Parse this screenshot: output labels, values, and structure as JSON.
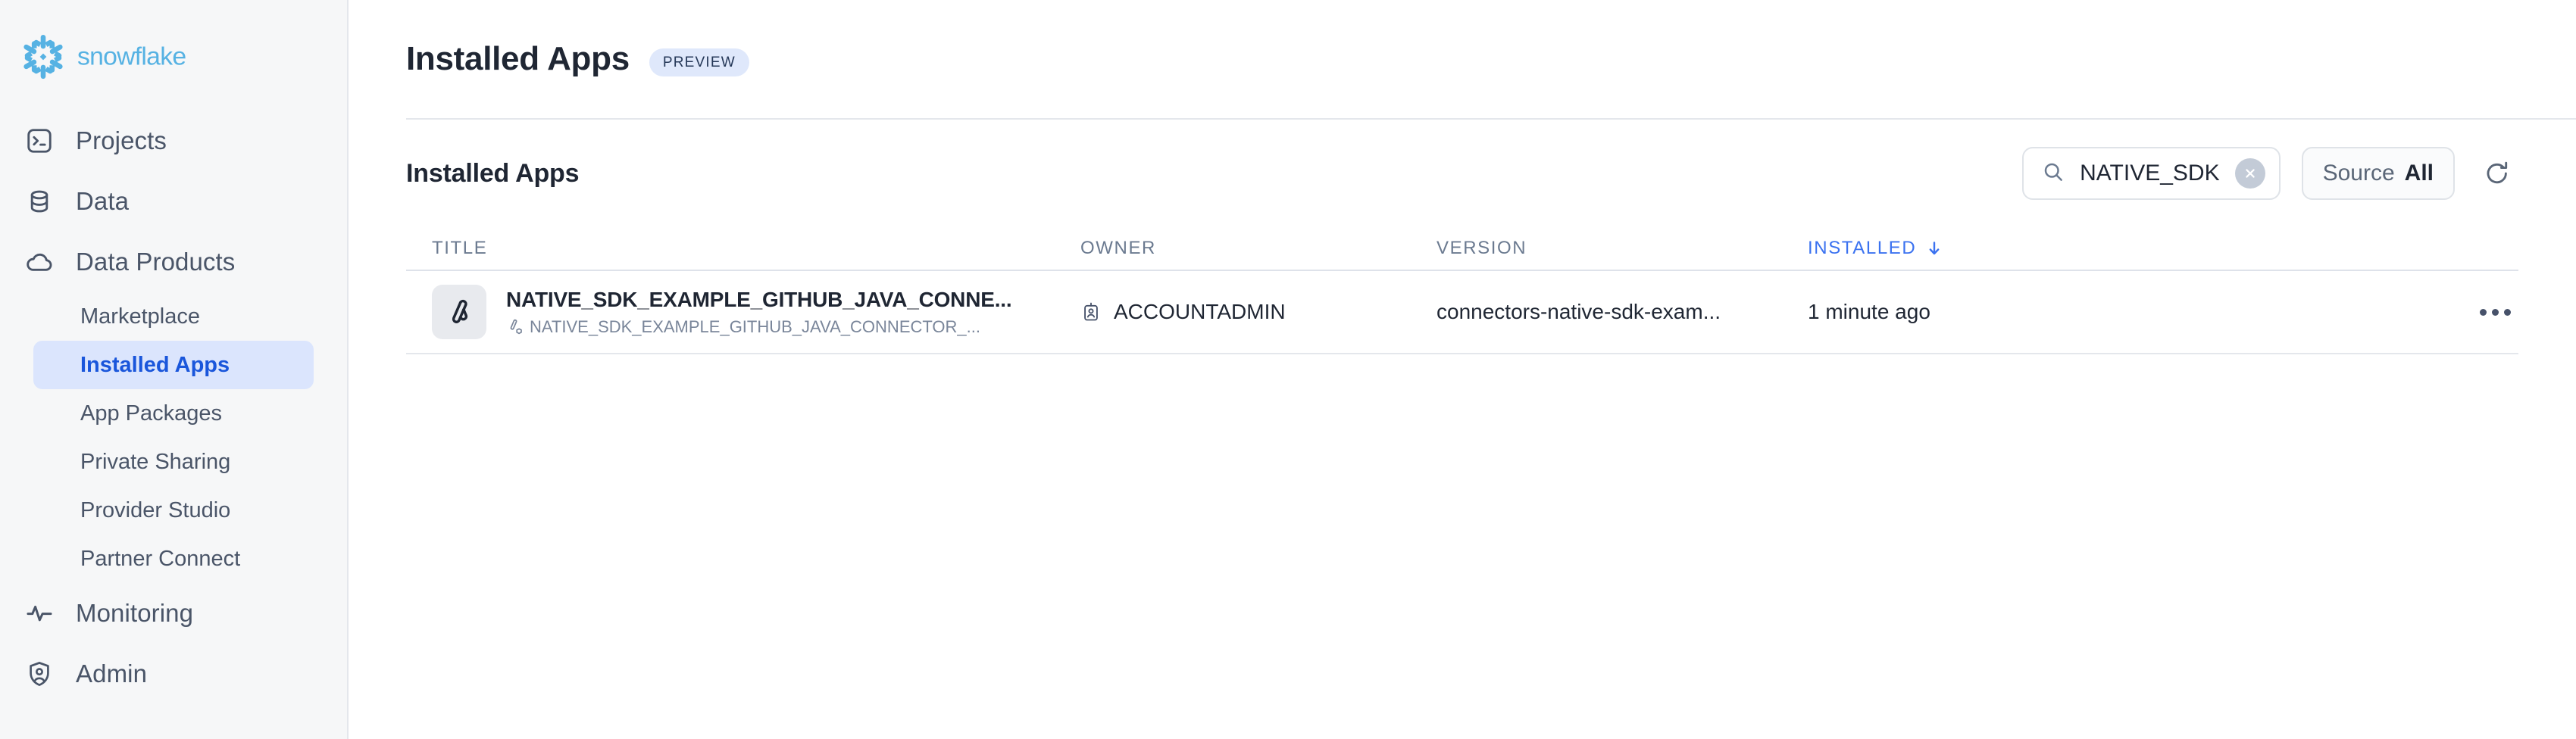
{
  "brand": {
    "name": "snowflake"
  },
  "sidebar": {
    "items": [
      {
        "label": "Projects",
        "icon": "terminal-icon",
        "type": "top"
      },
      {
        "label": "Data",
        "icon": "database-icon",
        "type": "top"
      },
      {
        "label": "Data Products",
        "icon": "cloud-icon",
        "type": "top"
      }
    ],
    "sub_items": [
      {
        "label": "Marketplace",
        "active": false
      },
      {
        "label": "Installed Apps",
        "active": true
      },
      {
        "label": "App Packages",
        "active": false
      },
      {
        "label": "Private Sharing",
        "active": false
      },
      {
        "label": "Provider Studio",
        "active": false
      },
      {
        "label": "Partner Connect",
        "active": false
      }
    ],
    "bottom_items": [
      {
        "label": "Monitoring",
        "icon": "activity-icon"
      },
      {
        "label": "Admin",
        "icon": "shield-user-icon"
      }
    ]
  },
  "header": {
    "title": "Installed Apps",
    "badge": "PREVIEW"
  },
  "section": {
    "title": "Installed Apps"
  },
  "search": {
    "value": "NATIVE_SDK",
    "placeholder": "Search",
    "icon": "search-icon",
    "clear_icon": "close-icon"
  },
  "filter": {
    "label": "Source",
    "value": "All"
  },
  "refresh": {
    "icon": "refresh-icon",
    "label": "Refresh"
  },
  "table": {
    "columns": [
      {
        "key": "title",
        "label": "TITLE",
        "sorted": false
      },
      {
        "key": "owner",
        "label": "OWNER",
        "sorted": false
      },
      {
        "key": "version",
        "label": "VERSION",
        "sorted": false
      },
      {
        "key": "installed",
        "label": "INSTALLED",
        "sorted": true,
        "sort_dir": "desc"
      }
    ],
    "rows": [
      {
        "icon": "native-app-icon",
        "title": "NATIVE_SDK_EXAMPLE_GITHUB_JAVA_CONNE...",
        "subtitle": "NATIVE_SDK_EXAMPLE_GITHUB_JAVA_CONNECTOR_...",
        "subtitle_icon": "app-package-icon",
        "owner": "ACCOUNTADMIN",
        "owner_icon": "role-badge-icon",
        "version": "connectors-native-sdk-exam...",
        "installed": "1 minute ago",
        "menu_icon": "more-options-icon"
      }
    ]
  },
  "colors": {
    "brand_blue": "#56b2e3",
    "accent_blue": "#3b72f0",
    "active_nav_bg": "#dbe5fd",
    "active_nav_text": "#1a56db",
    "badge_bg": "#dfe8fb",
    "sidebar_bg": "#f6f7f8",
    "text_primary": "#1f2633",
    "text_muted": "#6b7a90"
  }
}
